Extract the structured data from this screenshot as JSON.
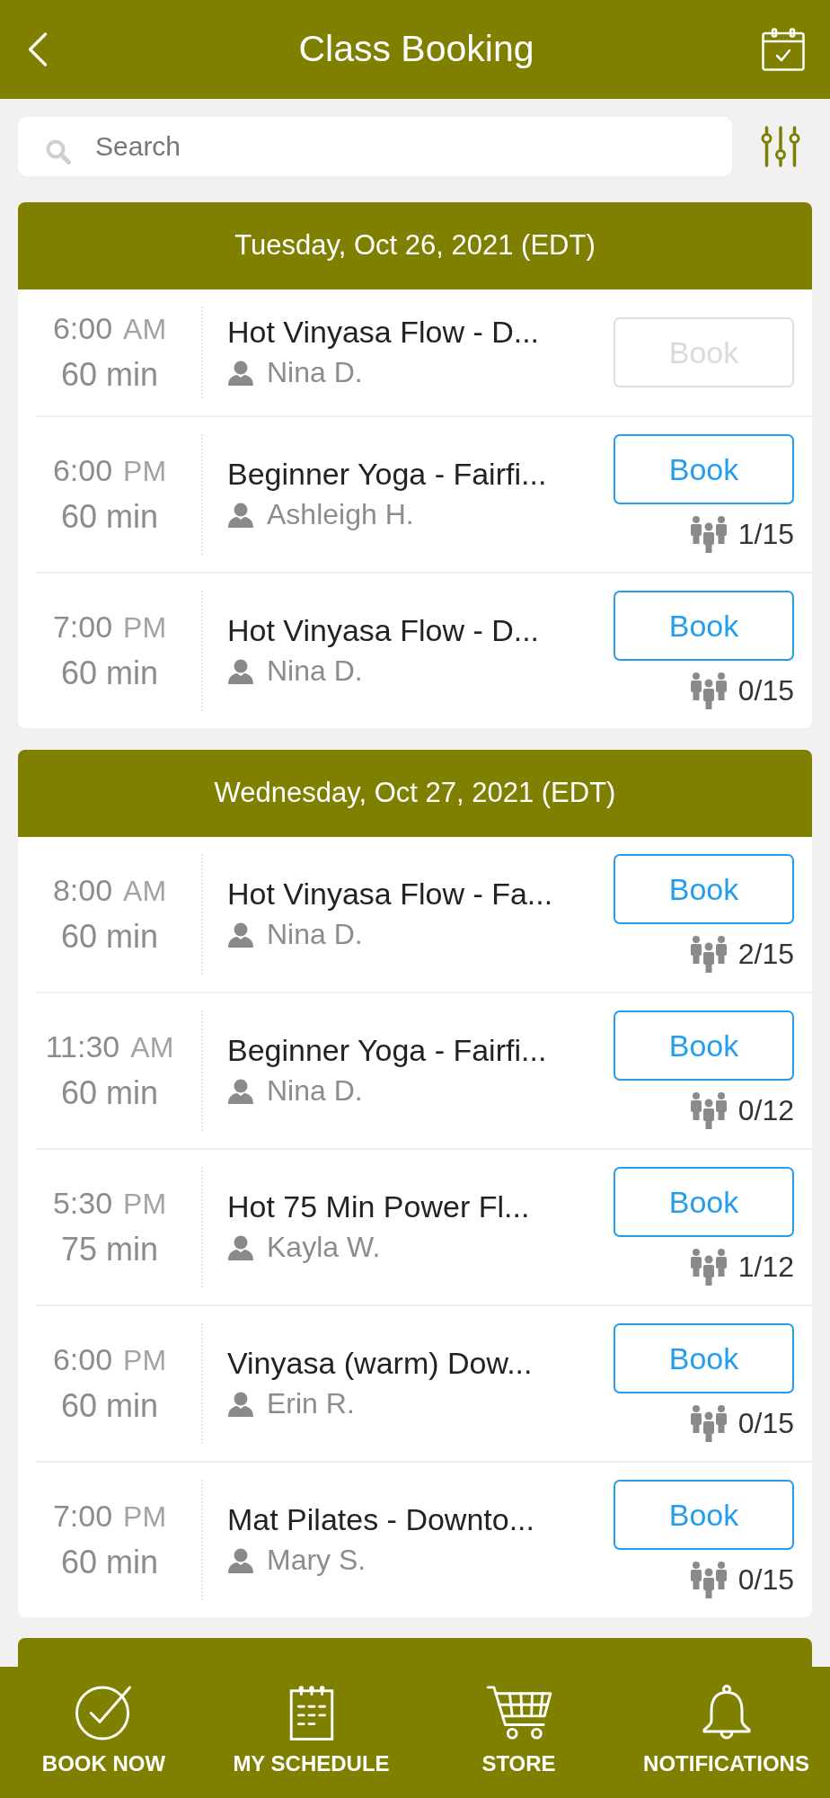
{
  "header": {
    "title": "Class Booking"
  },
  "search": {
    "placeholder": "Search"
  },
  "days": [
    {
      "date": "Tuesday, Oct 26, 2021 (EDT)",
      "classes": [
        {
          "time": "6:00",
          "period": "AM",
          "duration": "60 min",
          "title": "Hot Vinyasa Flow - D...",
          "instructor": "Nina D.",
          "button": {
            "label": "Book",
            "disabled": true
          }
        },
        {
          "time": "6:00",
          "period": "PM",
          "duration": "60 min",
          "title": "Beginner Yoga - Fairfi...",
          "instructor": "Ashleigh H.",
          "button": {
            "label": "Book",
            "disabled": false
          },
          "capacity": "1/15"
        },
        {
          "time": "7:00",
          "period": "PM",
          "duration": "60 min",
          "title": "Hot Vinyasa Flow - D...",
          "instructor": "Nina D.",
          "button": {
            "label": "Book",
            "disabled": false
          },
          "capacity": "0/15"
        }
      ]
    },
    {
      "date": "Wednesday, Oct 27, 2021 (EDT)",
      "classes": [
        {
          "time": "8:00",
          "period": "AM",
          "duration": "60 min",
          "title": "Hot Vinyasa Flow - Fa...",
          "instructor": "Nina D.",
          "button": {
            "label": "Book",
            "disabled": false
          },
          "capacity": "2/15"
        },
        {
          "time": "11:30",
          "period": "AM",
          "duration": "60 min",
          "title": "Beginner Yoga - Fairfi...",
          "instructor": "Nina D.",
          "button": {
            "label": "Book",
            "disabled": false
          },
          "capacity": "0/12"
        },
        {
          "time": "5:30",
          "period": "PM",
          "duration": "75 min",
          "title": "Hot 75 Min Power Fl...",
          "instructor": "Kayla W.",
          "button": {
            "label": "Book",
            "disabled": false
          },
          "capacity": "1/12"
        },
        {
          "time": "6:00",
          "period": "PM",
          "duration": "60 min",
          "title": "Vinyasa (warm) Dow...",
          "instructor": "Erin R.",
          "button": {
            "label": "Book",
            "disabled": false
          },
          "capacity": "0/15"
        },
        {
          "time": "7:00",
          "period": "PM",
          "duration": "60 min",
          "title": "Mat Pilates - Downto...",
          "instructor": "Mary S.",
          "button": {
            "label": "Book",
            "disabled": false
          },
          "capacity": "0/15"
        }
      ]
    }
  ],
  "more_days_below": true,
  "bottom_nav": [
    {
      "label": "BOOK NOW",
      "kind": "check"
    },
    {
      "label": "MY SCHEDULE",
      "kind": "schedule"
    },
    {
      "label": "STORE",
      "kind": "cart"
    },
    {
      "label": "NOTIFICATIONS",
      "kind": "bell"
    }
  ]
}
